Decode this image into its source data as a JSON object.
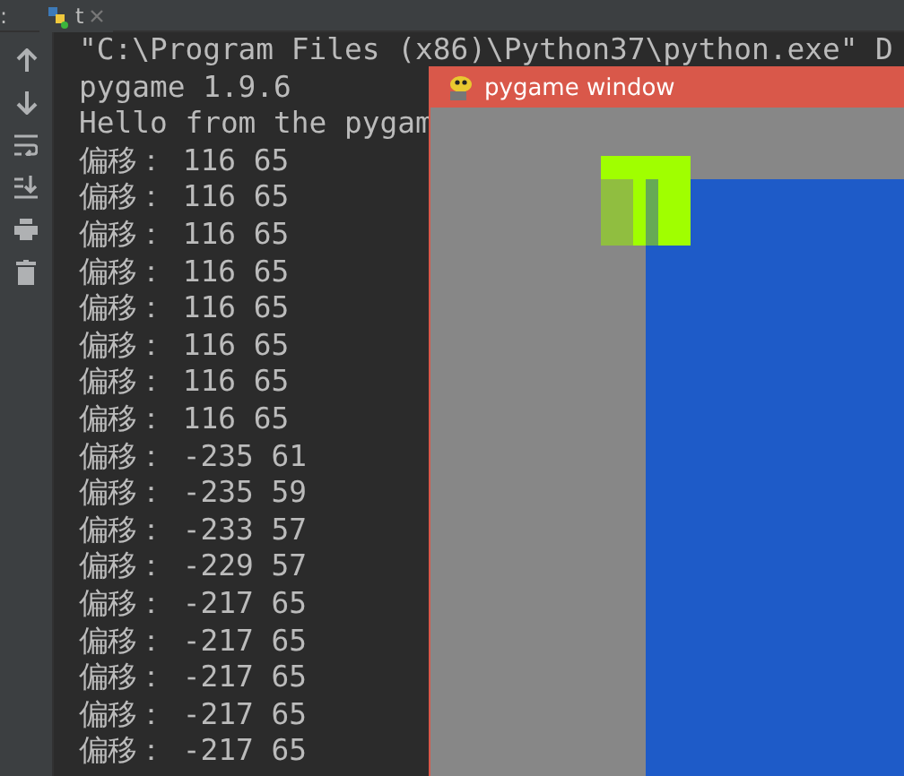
{
  "tab_bar": {
    "edge_label": ":",
    "tabs": [
      {
        "label": "t"
      }
    ]
  },
  "console": {
    "lines": [
      "\"C:\\Program Files (x86)\\Python37\\python.exe\" D",
      "pygame 1.9.6",
      "Hello from the pygam",
      "偏移： 116 65",
      "偏移： 116 65",
      "偏移： 116 65",
      "偏移： 116 65",
      "偏移： 116 65",
      "偏移： 116 65",
      "偏移： 116 65",
      "偏移： 116 65",
      "偏移： -235 61",
      "偏移： -235 59",
      "偏移： -233 57",
      "偏移： -229 57",
      "偏移： -217 65",
      "偏移： -217 65",
      "偏移： -217 65",
      "偏移： -217 65",
      "偏移： -217 65"
    ]
  },
  "pygame_window": {
    "title": "pygame window"
  }
}
